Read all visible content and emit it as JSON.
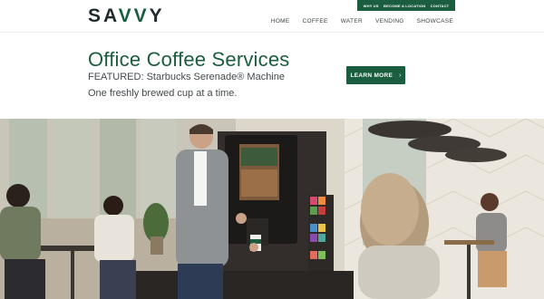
{
  "brand": {
    "logo_text": "SAVVY",
    "accent": "#1a5e3f"
  },
  "utility_links": [
    "WHY US",
    "BECOME A LOCATION",
    "CONTACT"
  ],
  "nav": [
    "HOME",
    "COFFEE",
    "WATER",
    "VENDING",
    "SHOWCASE"
  ],
  "hero": {
    "title": "Office Coffee Services",
    "featured": "FEATURED: Starbucks Serenade® Machine",
    "tagline": "One freshly brewed cup at a time.",
    "cta_label": "LEARN MORE",
    "cta_icon": "chevron-right-icon"
  }
}
